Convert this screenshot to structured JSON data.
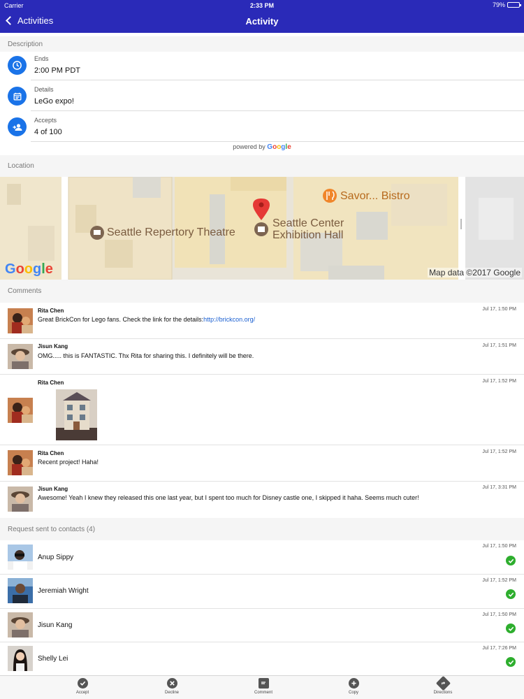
{
  "status_bar": {
    "carrier": "Carrier",
    "time": "2:33 PM",
    "battery": "79%",
    "battery_level": 0.79
  },
  "nav": {
    "back_label": "Activities",
    "title": "Activity"
  },
  "description": {
    "header": "Description",
    "rows": [
      {
        "label": "Ends",
        "value": "2:00 PM PDT",
        "icon": "clock-icon"
      },
      {
        "label": "Details",
        "value": "LeGo expo!",
        "icon": "calendar-icon"
      },
      {
        "label": "Accepts",
        "value": "4 of 100",
        "icon": "person-add-icon"
      }
    ],
    "powered_by": "powered by",
    "google": "Google"
  },
  "location": {
    "header": "Location",
    "map": {
      "venue": "Seattle Center Exhibition Hall",
      "venue_line1": "Seattle Center",
      "venue_line2": "Exhibition Hall",
      "theatre": "Seattle Repertory Theatre",
      "bistro": "Savor... Bistro",
      "logo": "Google",
      "attribution": "Map data ©2017 Google"
    }
  },
  "comments": {
    "header": "Comments",
    "items": [
      {
        "author": "Rita Chen",
        "text": "Great BrickCon for Lego fans. Check the link for the details:",
        "link": "http://brickcon.org/",
        "time": "Jul 17, 1:50 PM"
      },
      {
        "author": "Jisun Kang",
        "text": "OMG..... this is FANTASTIC. Thx Rita for sharing this. I definitely will be there.",
        "time": "Jul 17, 1:51 PM"
      },
      {
        "author": "Rita Chen",
        "text": "",
        "time": "Jul 17, 1:52 PM",
        "has_image": true
      },
      {
        "author": "Rita Chen",
        "text": "Recent project! Haha!",
        "time": "Jul 17, 1:52 PM"
      },
      {
        "author": "Jisun Kang",
        "text": "Awesome! Yeah I knew they released this one last year, but I spent too much for Disney castle one, I skipped it haha. Seems much cuter!",
        "time": "Jul 17, 3:31 PM"
      }
    ]
  },
  "contacts": {
    "header": "Request sent to contacts (4)",
    "items": [
      {
        "name": "Anup Sippy",
        "time": "Jul 17, 1:50 PM"
      },
      {
        "name": "Jeremiah Wright",
        "time": "Jul 17, 1:52 PM"
      },
      {
        "name": "Jisun Kang",
        "time": "Jul 17, 1:50 PM"
      },
      {
        "name": "Shelly Lei",
        "time": "Jul 17, 7:26 PM"
      }
    ]
  },
  "toolbar": {
    "items": [
      {
        "label": "Accept",
        "icon": "check-circle-icon"
      },
      {
        "label": "Decline",
        "icon": "x-circle-icon"
      },
      {
        "label": "Comment",
        "icon": "comment-icon"
      },
      {
        "label": "Copy",
        "icon": "plus-circle-icon"
      },
      {
        "label": "Directions",
        "icon": "directions-icon"
      }
    ]
  },
  "colors": {
    "nav_bg": "#2a2ab8",
    "accent_blue": "#1a73e8",
    "check_green": "#2eae2e",
    "link": "#1a5fd1"
  }
}
